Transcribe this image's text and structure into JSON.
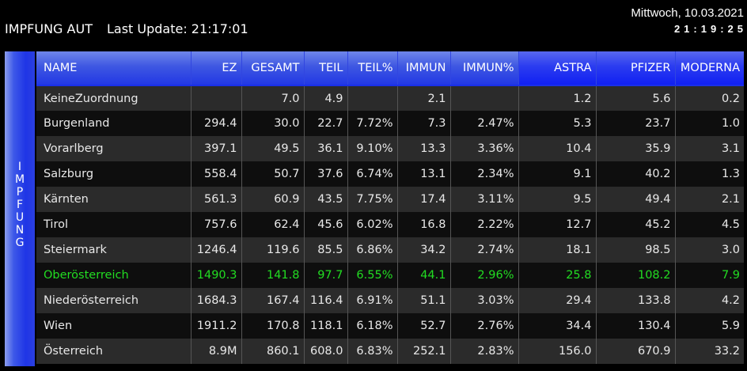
{
  "header": {
    "title": "IMPFUNG AUT",
    "update_label": "Last Update: 21:17:01"
  },
  "clock": {
    "date": "Mittwoch, 10.03.2021",
    "time": "21:19:25"
  },
  "side_label": [
    "I",
    "M",
    "P",
    "F",
    "U",
    "N",
    "G"
  ],
  "columns": [
    "NAME",
    "EZ",
    "GESAMT",
    "TEIL",
    "TEIL%",
    "IMMUN",
    "IMMUN%",
    "ASTRA",
    "PFIZER",
    "MODERNA"
  ],
  "colors": {
    "highlight": "#22dd22",
    "header_blue": "#2238e4"
  },
  "rows": [
    {
      "name": "KeineZuordnung",
      "ez": "",
      "gesamt": "7.0",
      "teil": "4.9",
      "teil_pct": "",
      "immun": "2.1",
      "immun_pct": "",
      "astra": "1.2",
      "pfizer": "5.6",
      "moderna": "0.2"
    },
    {
      "name": "Burgenland",
      "ez": "294.4",
      "gesamt": "30.0",
      "teil": "22.7",
      "teil_pct": "7.72%",
      "immun": "7.3",
      "immun_pct": "2.47%",
      "astra": "5.3",
      "pfizer": "23.7",
      "moderna": "1.0"
    },
    {
      "name": "Vorarlberg",
      "ez": "397.1",
      "gesamt": "49.5",
      "teil": "36.1",
      "teil_pct": "9.10%",
      "immun": "13.3",
      "immun_pct": "3.36%",
      "astra": "10.4",
      "pfizer": "35.9",
      "moderna": "3.1"
    },
    {
      "name": "Salzburg",
      "ez": "558.4",
      "gesamt": "50.7",
      "teil": "37.6",
      "teil_pct": "6.74%",
      "immun": "13.1",
      "immun_pct": "2.34%",
      "astra": "9.1",
      "pfizer": "40.2",
      "moderna": "1.3"
    },
    {
      "name": "Kärnten",
      "ez": "561.3",
      "gesamt": "60.9",
      "teil": "43.5",
      "teil_pct": "7.75%",
      "immun": "17.4",
      "immun_pct": "3.11%",
      "astra": "9.5",
      "pfizer": "49.4",
      "moderna": "2.1"
    },
    {
      "name": "Tirol",
      "ez": "757.6",
      "gesamt": "62.4",
      "teil": "45.6",
      "teil_pct": "6.02%",
      "immun": "16.8",
      "immun_pct": "2.22%",
      "astra": "12.7",
      "pfizer": "45.2",
      "moderna": "4.5"
    },
    {
      "name": "Steiermark",
      "ez": "1246.4",
      "gesamt": "119.6",
      "teil": "85.5",
      "teil_pct": "6.86%",
      "immun": "34.2",
      "immun_pct": "2.74%",
      "astra": "18.1",
      "pfizer": "98.5",
      "moderna": "3.0"
    },
    {
      "name": "Oberösterreich",
      "ez": "1490.3",
      "gesamt": "141.8",
      "teil": "97.7",
      "teil_pct": "6.55%",
      "immun": "44.1",
      "immun_pct": "2.96%",
      "astra": "25.8",
      "pfizer": "108.2",
      "moderna": "7.9"
    },
    {
      "name": "Niederösterreich",
      "ez": "1684.3",
      "gesamt": "167.4",
      "teil": "116.4",
      "teil_pct": "6.91%",
      "immun": "51.1",
      "immun_pct": "3.03%",
      "astra": "29.4",
      "pfizer": "133.8",
      "moderna": "4.2"
    },
    {
      "name": "Wien",
      "ez": "1911.2",
      "gesamt": "170.8",
      "teil": "118.1",
      "teil_pct": "6.18%",
      "immun": "52.7",
      "immun_pct": "2.76%",
      "astra": "34.4",
      "pfizer": "130.4",
      "moderna": "5.9"
    },
    {
      "name": "Österreich",
      "ez": "8.9M",
      "gesamt": "860.1",
      "teil": "608.0",
      "teil_pct": "6.83%",
      "immun": "252.1",
      "immun_pct": "2.83%",
      "astra": "156.0",
      "pfizer": "670.9",
      "moderna": "33.2"
    }
  ]
}
